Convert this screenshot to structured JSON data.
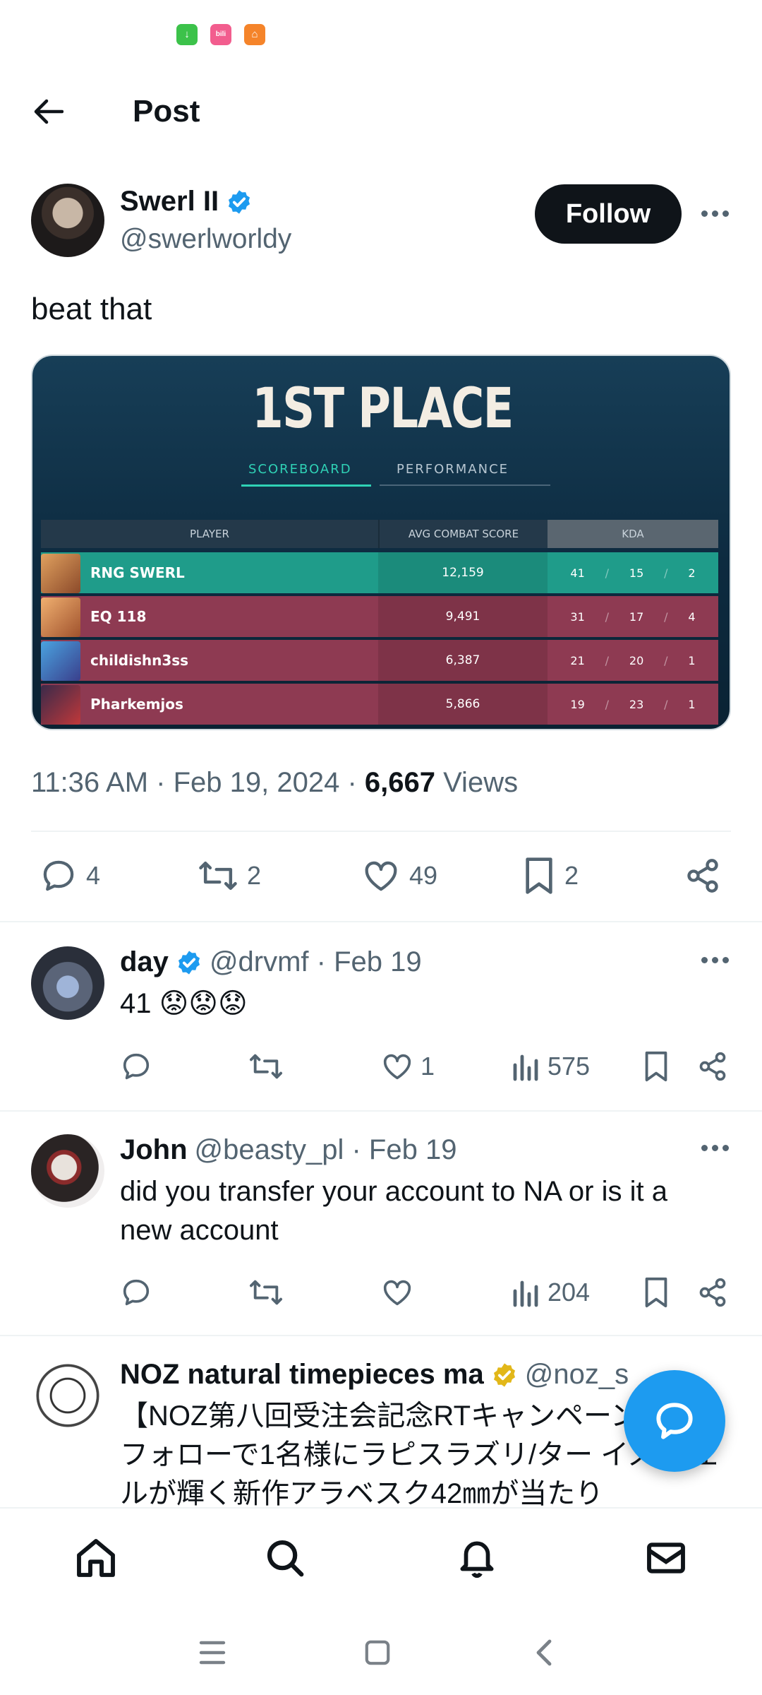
{
  "status_bar": {
    "icons": [
      "download-app-icon",
      "bilibili-app-icon",
      "home-app-icon"
    ],
    "colors": [
      "#3cc24a",
      "#f25d8e",
      "#f5842a"
    ]
  },
  "header": {
    "title": "Post",
    "back_icon": "arrow-left-icon"
  },
  "post": {
    "author_name": "Swerl II",
    "author_handle": "@swerlworldy",
    "follow_label": "Follow",
    "text": "beat that",
    "timestamp": "11:36 AM · Feb 19, 2024 · ",
    "views_count": "6,667",
    "views_label": " Views",
    "actions": {
      "replies": "4",
      "reposts": "2",
      "likes": "49",
      "bookmarks": "2"
    }
  },
  "media": {
    "title": "1ST PLACE",
    "tabs": [
      "SCOREBOARD",
      "PERFORMANCE"
    ],
    "columns": [
      "PLAYER",
      "AVG COMBAT SCORE",
      "KDA"
    ],
    "rows": [
      {
        "player": "RNG SWERL",
        "acs": "12,159",
        "k": "41",
        "d": "15",
        "a": "2"
      },
      {
        "player": "EQ 118",
        "acs": "9,491",
        "k": "31",
        "d": "17",
        "a": "4"
      },
      {
        "player": "childishn3ss",
        "acs": "6,387",
        "k": "21",
        "d": "20",
        "a": "1"
      },
      {
        "player": "Pharkemjos",
        "acs": "5,866",
        "k": "19",
        "d": "23",
        "a": "1"
      }
    ],
    "separator": "/"
  },
  "replies": [
    {
      "name": "day",
      "handle": "@drvmf · Feb 19",
      "text": "41 😟😟😟",
      "likes": "1",
      "views": "575"
    },
    {
      "name": "John",
      "handle": "@beasty_pl · Feb 19",
      "text": "did you transfer your account to NA or is it a new account",
      "likes": "",
      "views": "204"
    },
    {
      "name": "NOZ natural timepieces ma",
      "handle": "@noz_s",
      "text": "【NOZ第八回受注会記念RTキャンペーン RT&フォローで1名様にラピスラズリ/ター イズ/シェルが輝く新作アラベスク42㎜が当たり"
    }
  ],
  "colors": {
    "accent": "#1d9bf0",
    "text": "#0f1419",
    "muted": "#536471",
    "gold": "#e2b719"
  }
}
